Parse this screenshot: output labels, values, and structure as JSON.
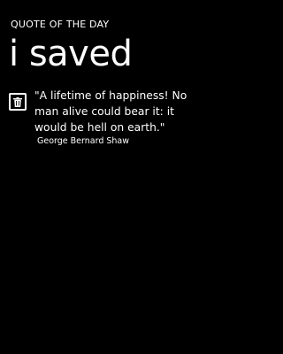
{
  "header": {
    "app_title": "QUOTE OF THE DAY",
    "page_title": "i saved"
  },
  "saved_quotes": [
    {
      "text": "\"A lifetime of happiness! No man alive could bear it: it would be hell on earth.\"",
      "author": "George Bernard Shaw",
      "action_icon": "trash-icon"
    }
  ],
  "colors": {
    "background": "#000000",
    "foreground": "#ffffff"
  }
}
